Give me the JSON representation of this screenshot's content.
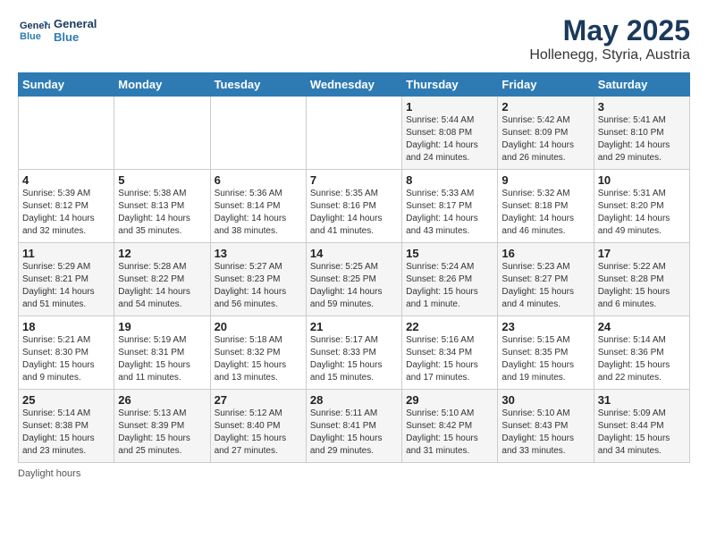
{
  "header": {
    "logo_line1": "General",
    "logo_line2": "Blue",
    "month_title": "May 2025",
    "location": "Hollenegg, Styria, Austria"
  },
  "days_of_week": [
    "Sunday",
    "Monday",
    "Tuesday",
    "Wednesday",
    "Thursday",
    "Friday",
    "Saturday"
  ],
  "weeks": [
    [
      {
        "num": "",
        "sunrise": "",
        "sunset": "",
        "daylight": ""
      },
      {
        "num": "",
        "sunrise": "",
        "sunset": "",
        "daylight": ""
      },
      {
        "num": "",
        "sunrise": "",
        "sunset": "",
        "daylight": ""
      },
      {
        "num": "",
        "sunrise": "",
        "sunset": "",
        "daylight": ""
      },
      {
        "num": "1",
        "sunrise": "Sunrise: 5:44 AM",
        "sunset": "Sunset: 8:08 PM",
        "daylight": "Daylight: 14 hours and 24 minutes."
      },
      {
        "num": "2",
        "sunrise": "Sunrise: 5:42 AM",
        "sunset": "Sunset: 8:09 PM",
        "daylight": "Daylight: 14 hours and 26 minutes."
      },
      {
        "num": "3",
        "sunrise": "Sunrise: 5:41 AM",
        "sunset": "Sunset: 8:10 PM",
        "daylight": "Daylight: 14 hours and 29 minutes."
      }
    ],
    [
      {
        "num": "4",
        "sunrise": "Sunrise: 5:39 AM",
        "sunset": "Sunset: 8:12 PM",
        "daylight": "Daylight: 14 hours and 32 minutes."
      },
      {
        "num": "5",
        "sunrise": "Sunrise: 5:38 AM",
        "sunset": "Sunset: 8:13 PM",
        "daylight": "Daylight: 14 hours and 35 minutes."
      },
      {
        "num": "6",
        "sunrise": "Sunrise: 5:36 AM",
        "sunset": "Sunset: 8:14 PM",
        "daylight": "Daylight: 14 hours and 38 minutes."
      },
      {
        "num": "7",
        "sunrise": "Sunrise: 5:35 AM",
        "sunset": "Sunset: 8:16 PM",
        "daylight": "Daylight: 14 hours and 41 minutes."
      },
      {
        "num": "8",
        "sunrise": "Sunrise: 5:33 AM",
        "sunset": "Sunset: 8:17 PM",
        "daylight": "Daylight: 14 hours and 43 minutes."
      },
      {
        "num": "9",
        "sunrise": "Sunrise: 5:32 AM",
        "sunset": "Sunset: 8:18 PM",
        "daylight": "Daylight: 14 hours and 46 minutes."
      },
      {
        "num": "10",
        "sunrise": "Sunrise: 5:31 AM",
        "sunset": "Sunset: 8:20 PM",
        "daylight": "Daylight: 14 hours and 49 minutes."
      }
    ],
    [
      {
        "num": "11",
        "sunrise": "Sunrise: 5:29 AM",
        "sunset": "Sunset: 8:21 PM",
        "daylight": "Daylight: 14 hours and 51 minutes."
      },
      {
        "num": "12",
        "sunrise": "Sunrise: 5:28 AM",
        "sunset": "Sunset: 8:22 PM",
        "daylight": "Daylight: 14 hours and 54 minutes."
      },
      {
        "num": "13",
        "sunrise": "Sunrise: 5:27 AM",
        "sunset": "Sunset: 8:23 PM",
        "daylight": "Daylight: 14 hours and 56 minutes."
      },
      {
        "num": "14",
        "sunrise": "Sunrise: 5:25 AM",
        "sunset": "Sunset: 8:25 PM",
        "daylight": "Daylight: 14 hours and 59 minutes."
      },
      {
        "num": "15",
        "sunrise": "Sunrise: 5:24 AM",
        "sunset": "Sunset: 8:26 PM",
        "daylight": "Daylight: 15 hours and 1 minute."
      },
      {
        "num": "16",
        "sunrise": "Sunrise: 5:23 AM",
        "sunset": "Sunset: 8:27 PM",
        "daylight": "Daylight: 15 hours and 4 minutes."
      },
      {
        "num": "17",
        "sunrise": "Sunrise: 5:22 AM",
        "sunset": "Sunset: 8:28 PM",
        "daylight": "Daylight: 15 hours and 6 minutes."
      }
    ],
    [
      {
        "num": "18",
        "sunrise": "Sunrise: 5:21 AM",
        "sunset": "Sunset: 8:30 PM",
        "daylight": "Daylight: 15 hours and 9 minutes."
      },
      {
        "num": "19",
        "sunrise": "Sunrise: 5:19 AM",
        "sunset": "Sunset: 8:31 PM",
        "daylight": "Daylight: 15 hours and 11 minutes."
      },
      {
        "num": "20",
        "sunrise": "Sunrise: 5:18 AM",
        "sunset": "Sunset: 8:32 PM",
        "daylight": "Daylight: 15 hours and 13 minutes."
      },
      {
        "num": "21",
        "sunrise": "Sunrise: 5:17 AM",
        "sunset": "Sunset: 8:33 PM",
        "daylight": "Daylight: 15 hours and 15 minutes."
      },
      {
        "num": "22",
        "sunrise": "Sunrise: 5:16 AM",
        "sunset": "Sunset: 8:34 PM",
        "daylight": "Daylight: 15 hours and 17 minutes."
      },
      {
        "num": "23",
        "sunrise": "Sunrise: 5:15 AM",
        "sunset": "Sunset: 8:35 PM",
        "daylight": "Daylight: 15 hours and 19 minutes."
      },
      {
        "num": "24",
        "sunrise": "Sunrise: 5:14 AM",
        "sunset": "Sunset: 8:36 PM",
        "daylight": "Daylight: 15 hours and 22 minutes."
      }
    ],
    [
      {
        "num": "25",
        "sunrise": "Sunrise: 5:14 AM",
        "sunset": "Sunset: 8:38 PM",
        "daylight": "Daylight: 15 hours and 23 minutes."
      },
      {
        "num": "26",
        "sunrise": "Sunrise: 5:13 AM",
        "sunset": "Sunset: 8:39 PM",
        "daylight": "Daylight: 15 hours and 25 minutes."
      },
      {
        "num": "27",
        "sunrise": "Sunrise: 5:12 AM",
        "sunset": "Sunset: 8:40 PM",
        "daylight": "Daylight: 15 hours and 27 minutes."
      },
      {
        "num": "28",
        "sunrise": "Sunrise: 5:11 AM",
        "sunset": "Sunset: 8:41 PM",
        "daylight": "Daylight: 15 hours and 29 minutes."
      },
      {
        "num": "29",
        "sunrise": "Sunrise: 5:10 AM",
        "sunset": "Sunset: 8:42 PM",
        "daylight": "Daylight: 15 hours and 31 minutes."
      },
      {
        "num": "30",
        "sunrise": "Sunrise: 5:10 AM",
        "sunset": "Sunset: 8:43 PM",
        "daylight": "Daylight: 15 hours and 33 minutes."
      },
      {
        "num": "31",
        "sunrise": "Sunrise: 5:09 AM",
        "sunset": "Sunset: 8:44 PM",
        "daylight": "Daylight: 15 hours and 34 minutes."
      }
    ]
  ],
  "footer": {
    "daylight_label": "Daylight hours"
  }
}
